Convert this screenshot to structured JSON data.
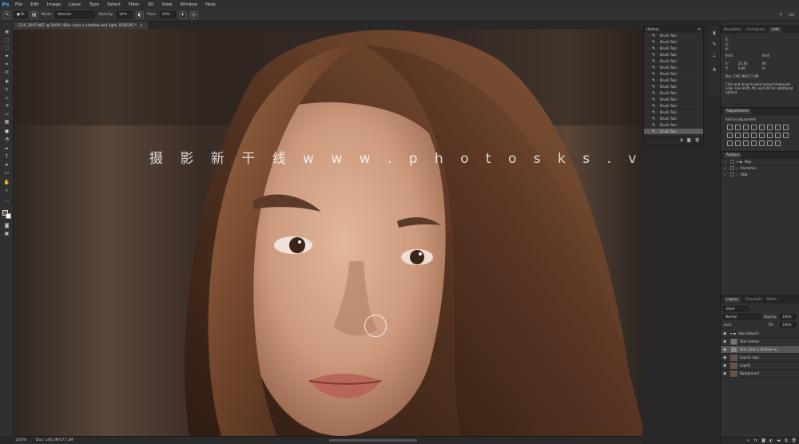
{
  "app": {
    "logo": "Ps",
    "menu": [
      "File",
      "Edit",
      "Image",
      "Layer",
      "Type",
      "Select",
      "Filter",
      "3D",
      "View",
      "Window",
      "Help"
    ]
  },
  "options": {
    "brush_size": "30",
    "mode_label": "Mode:",
    "mode_value": "Normal",
    "opacity_label": "Opacity:",
    "opacity_value": "14%",
    "flow_label": "Flow:",
    "flow_value": "10%"
  },
  "document": {
    "tab_title": "G16_2647.NEF @ 200% (Skin color a shadow and light, RGB/16) *",
    "close": "×",
    "zoom": "200%",
    "doc_size": "Doc: 146,3M/177,3M"
  },
  "watermark": "摄 影 新 干 线   w w w . p h o t o s k s . v i p",
  "history": {
    "title": "History",
    "items": [
      "Brush Tool",
      "Brush Tool",
      "Brush Tool",
      "Brush Tool",
      "Brush Tool",
      "Brush Tool",
      "Brush Tool",
      "Brush Tool",
      "Brush Tool",
      "Brush Tool",
      "Brush Tool",
      "Brush Tool",
      "Brush Tool",
      "Brush Tool",
      "Brush Tool",
      "Brush Tool"
    ],
    "selected_index": 15
  },
  "info_panel": {
    "tabs": [
      "Navigator",
      "Histogram",
      "Info"
    ],
    "active_tab": "Info",
    "r": "R:",
    "g": "G:",
    "b": "B:",
    "bit_left": "8-bit",
    "bit_right": "8-bit",
    "x": "X:",
    "y": "Y:",
    "x_val": "25.46",
    "y_val": "6.80",
    "w": "W:",
    "h": "H:",
    "doc": "Doc: 146,3M/177,3M",
    "hint": "Click and drag to paint using foreground color. Use Shift, Alt, and Ctrl for additional options."
  },
  "adjustments": {
    "title": "Adjustments",
    "subtitle": "Add an adjustment"
  },
  "actions": {
    "title": "Actions",
    "rows": [
      {
        "label": "Max",
        "level": 0
      },
      {
        "label": "Частотка",
        "level": 1
      },
      {
        "label": "D&B",
        "level": 1
      }
    ]
  },
  "layers_panel": {
    "tabs": [
      "Layers",
      "Channels",
      "Paths"
    ],
    "active_tab": "Layers",
    "kind": "Kind",
    "blend": "Normal",
    "opacity_label": "Opacity:",
    "opacity_value": "100%",
    "lock_label": "Lock:",
    "fill_label": "Fill:",
    "fill_value": "100%",
    "layers": [
      {
        "name": "Skin retouch",
        "type": "group"
      },
      {
        "name": "Skin texture",
        "type": "layer"
      },
      {
        "name": "Skin color a shadow an...",
        "type": "layer",
        "selected": true
      },
      {
        "name": "Liquify copy",
        "type": "layer"
      },
      {
        "name": "Liquify",
        "type": "layer"
      },
      {
        "name": "Background",
        "type": "layer"
      }
    ]
  }
}
